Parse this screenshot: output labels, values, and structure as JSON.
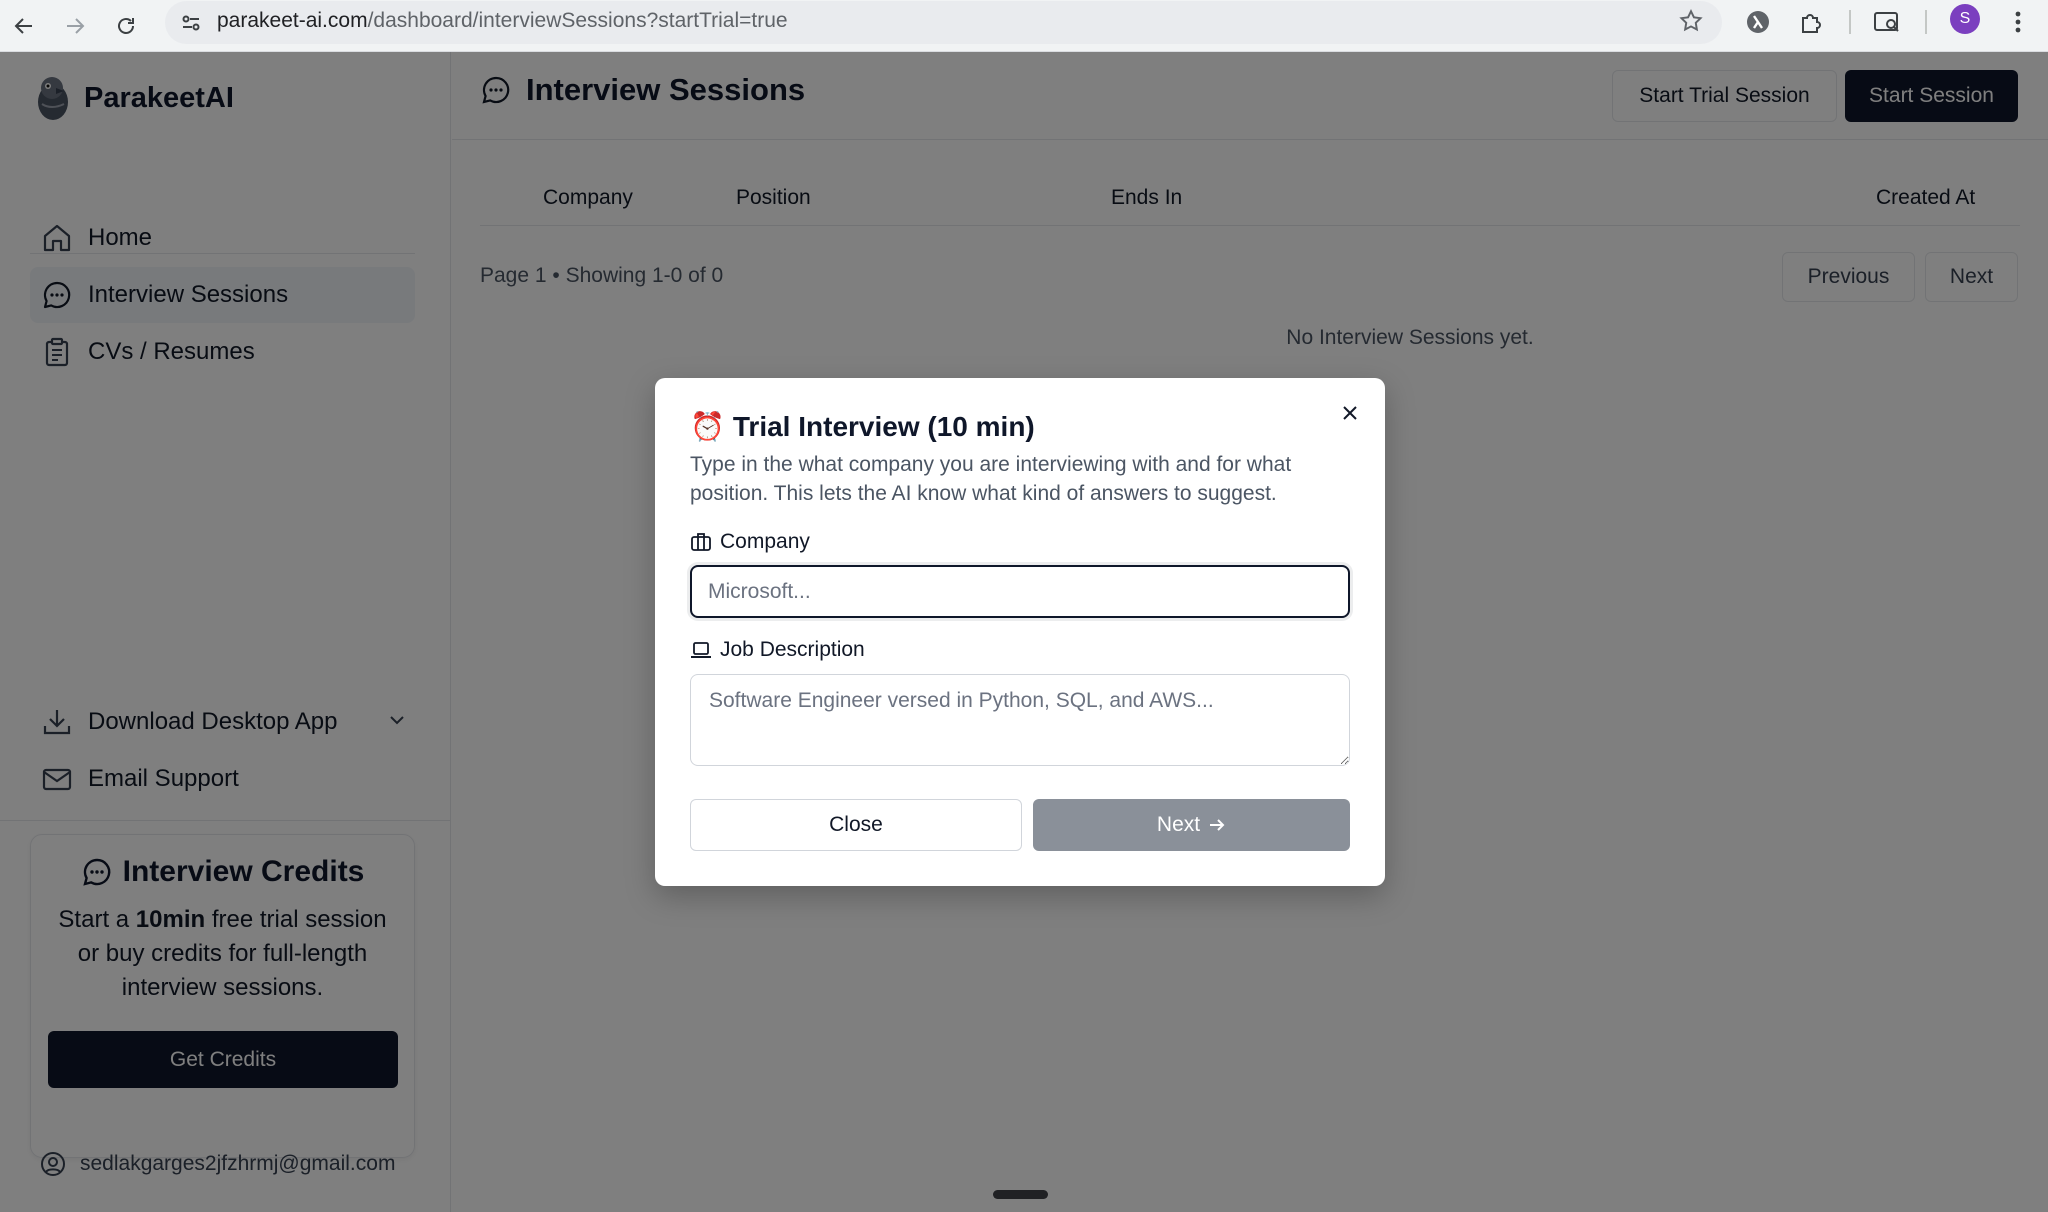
{
  "browser": {
    "url_domain": "parakeet-ai.com",
    "url_path": "/dashboard/interviewSessions?startTrial=true",
    "profile_initial": "S"
  },
  "sidebar": {
    "app_name": "ParakeetAI",
    "nav": [
      {
        "label": "Home",
        "icon": "home-icon"
      },
      {
        "label": "Interview Sessions",
        "icon": "chat-bubble-icon",
        "active": true
      },
      {
        "label": "CVs / Resumes",
        "icon": "clipboard-icon"
      }
    ],
    "download_label": "Download Desktop App",
    "email_support_label": "Email Support",
    "credits": {
      "title": "Interview Credits",
      "text_prefix": "Start a ",
      "text_bold": "10min",
      "text_suffix": " free trial session or buy credits for full-length interview sessions.",
      "button": "Get Credits"
    },
    "user_email": "sedlakgarges2jfzhrmj@gmail.com"
  },
  "header": {
    "title": "Interview Sessions",
    "trial_button": "Start Trial Session",
    "session_button": "Start Session"
  },
  "table": {
    "columns": [
      "Company",
      "Position",
      "Ends In",
      "Created At"
    ],
    "pager_text": "Page 1 • Showing 1-0 of 0",
    "previous": "Previous",
    "next": "Next",
    "empty": "No Interview Sessions yet."
  },
  "modal": {
    "emoji": "⏰",
    "title": "Trial Interview (10 min)",
    "description": "Type in the what company you are interviewing with and for what position. This lets the AI know what kind of answers to suggest.",
    "company_label": "Company",
    "company_placeholder": "Microsoft...",
    "job_label": "Job Description",
    "job_placeholder": "Software Engineer versed in Python, SQL, and AWS...",
    "close_button": "Close",
    "next_button": "Next"
  },
  "colors": {
    "primary_dark": "#0f172a",
    "disabled_button": "#8a9099",
    "overlay": "rgba(0,0,0,0.5)",
    "profile": "#7b3fbf"
  }
}
